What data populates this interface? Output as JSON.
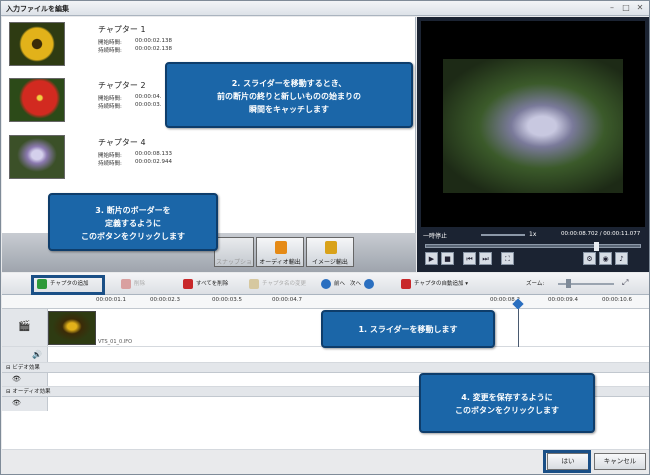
{
  "window": {
    "title": "入力ファイルを編集",
    "controls": [
      "–",
      "□",
      "✕"
    ]
  },
  "chapters": [
    {
      "name": "チャプター 1",
      "start_label": "開始時間:",
      "start": "00:00:02.138",
      "dur_label": "持続時間:",
      "dur": "00:00:02.138",
      "thumb_color": "#c79a10"
    },
    {
      "name": "チャプター 2",
      "start_label": "開始時間:",
      "start": "00:00:04.",
      "dur_label": "持続時間:",
      "dur": "00:00:03.",
      "thumb_color": "#c0281e"
    },
    {
      "name": "チャプター 4",
      "start_label": "開始時間:",
      "start": "00:00:08.133",
      "dur_label": "持続時間:",
      "dur": "00:00:02.944",
      "thumb_color": "#7a6aa0"
    }
  ],
  "midbar": {
    "audio_export": "オーディオ輸出",
    "image_export": "イメージ輸出",
    "snapshot": "スナップショ"
  },
  "player": {
    "state": "一時停止",
    "speed": "1x",
    "time": "00:00:08.702 / 00:00:11.077"
  },
  "toolbar": {
    "add_chapter": "チャプタの追加",
    "delete": "削除",
    "delete_all": "すべてを削除",
    "rename": "チャプタ名の変更",
    "prev": "前へ",
    "next": "次へ",
    "auto_add": "チャプタの自動追加",
    "zoom": "ズーム:"
  },
  "ruler": [
    "00:00:01.1",
    "00:00:02.3",
    "00:00:03.5",
    "00:00:04.7",
    "00:00:08.2",
    "00:00:09.4",
    "00:00:10.6"
  ],
  "clip_label": "VTS_01_0.IFO",
  "sections": {
    "video_effects": "ビデオ効果",
    "audio_effects": "オーディオ効果"
  },
  "buttons": {
    "ok": "はい",
    "cancel": "キャンセル"
  },
  "callouts": {
    "c1": "1. スライダーを移動します",
    "c2_lines": [
      "2. スライダーを移動するとき、",
      "前の断片の終りと新しいものの始まりの",
      "瞬間をキャッチします"
    ],
    "c3_lines": [
      "3. 断片のボーダーを",
      "定義するように",
      "このボタンをクリックします"
    ],
    "c4_lines": [
      "4. 変更を保存するように",
      "このボタンをクリックします"
    ]
  },
  "colors": {
    "callout_bg": "#1b66a8",
    "player_bg": "#1b2332"
  }
}
